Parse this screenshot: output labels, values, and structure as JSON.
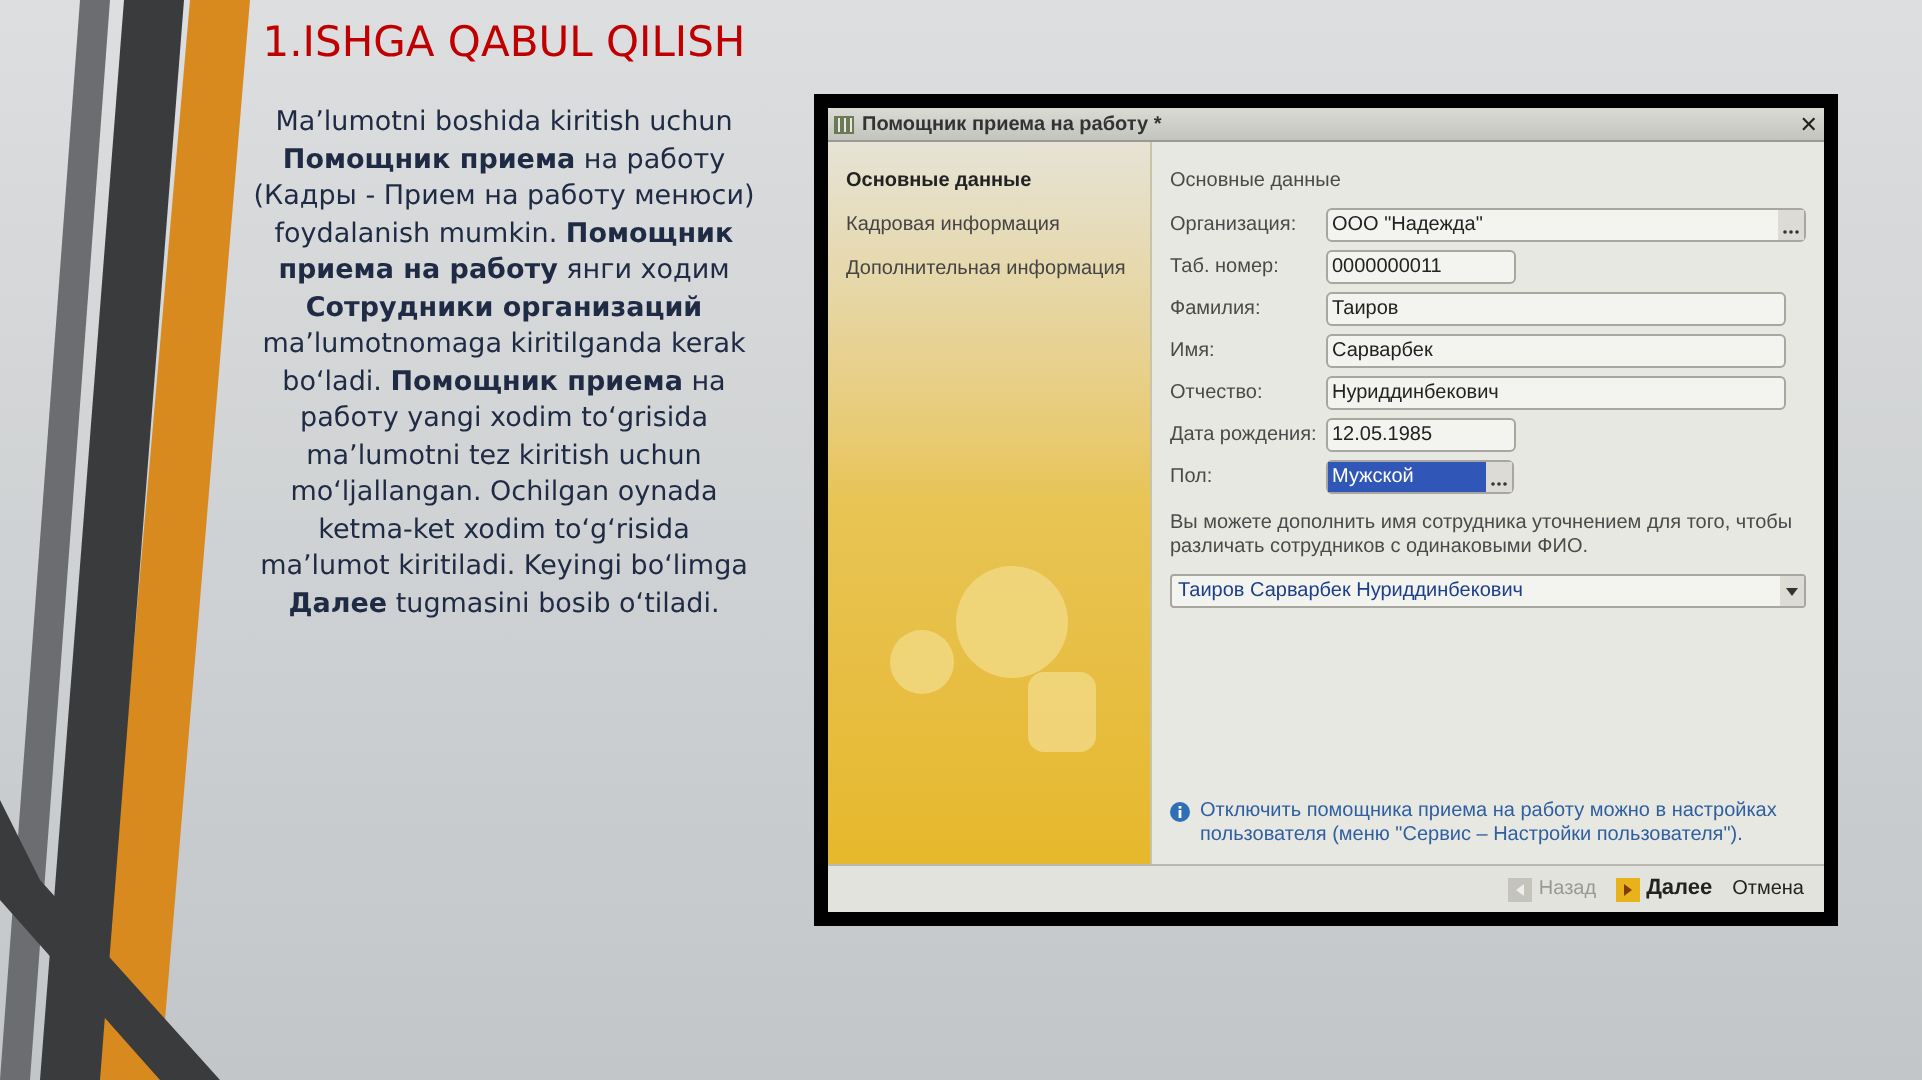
{
  "slide": {
    "title": "1.ISHGA QABUL QILISH",
    "body": "Ma’lumotni boshida kiritish uchun **Помощник приема** на работу (Кадры - Прием на работу менюси) foydalanish mumkin. **Помощник приема на работу** янги ходим **Сотрудники организаций** ma’lumotnomaga kiritilganda kerak bo‘ladi. **Помощник приема** на работу yangi xodim to‘grisida ma’lumotni tez kiritish uchun mo‘ljallangan. Ochilgan oynada ketma-ket xodim to‘g‘risida ma’lumot kiritiladi. Keyingi bo‘limga **Далее** tugmasini bosib o‘tiladi."
  },
  "window": {
    "title": "Помощник приема на работу *",
    "close": "✕",
    "nav": [
      {
        "label": "Основные данные",
        "selected": true
      },
      {
        "label": "Кадровая информация",
        "selected": false
      },
      {
        "label": "Дополнительная информация",
        "selected": false
      }
    ],
    "section_title": "Основные данные",
    "fields": [
      {
        "label": "Организация:",
        "value": "ООО \"Надежда\"",
        "kind": "lookup",
        "selected": false
      },
      {
        "label": "Таб. номер:",
        "value": "0000000011",
        "kind": "short",
        "selected": false
      },
      {
        "label": "Фамилия:",
        "value": "Таиров",
        "kind": "text",
        "selected": false
      },
      {
        "label": "Имя:",
        "value": "Сарварбек",
        "kind": "text",
        "selected": false
      },
      {
        "label": "Отчество:",
        "value": "Нуриддинбекович",
        "kind": "text",
        "selected": false
      },
      {
        "label": "Дата рождения:",
        "value": "12.05.1985",
        "kind": "short",
        "selected": false
      },
      {
        "label": "Пол:",
        "value": "Мужской",
        "kind": "choice",
        "selected": true
      }
    ],
    "hint": "Вы можете дополнить имя сотрудника уточнением для того, чтобы различать сотрудников с одинаковыми ФИО.",
    "full_name": "Таиров Сарварбек Нуриддинбекович",
    "info": "Отключить помощника приема на работу можно в настройках пользователя (меню \"Сервис – Настройки пользователя\").",
    "buttons": [
      {
        "label": "Назад",
        "kind": "back",
        "disabled": true
      },
      {
        "label": "Далее",
        "kind": "next",
        "disabled": false
      },
      {
        "label": "Отмена",
        "kind": "cancel",
        "disabled": false
      }
    ]
  }
}
